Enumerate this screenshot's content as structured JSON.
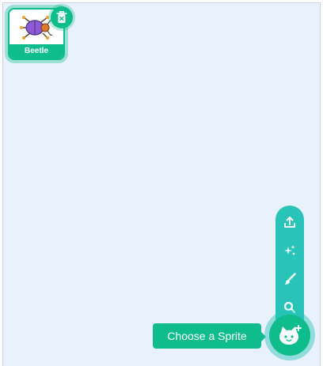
{
  "sprite_list": {
    "sprites": [
      {
        "name": "Beetle",
        "thumbnail_icon": "beetle-icon",
        "selected": true
      }
    ],
    "delete_icon": "trash-icon"
  },
  "sprite_menu": {
    "items": [
      {
        "icon": "upload-icon"
      },
      {
        "icon": "surprise-icon"
      },
      {
        "icon": "paint-icon"
      },
      {
        "icon": "search-icon"
      }
    ],
    "main_button_icon": "cat-plus-icon",
    "tooltip": "Choose a Sprite"
  },
  "colors": {
    "pane_background": "#e9f1fc",
    "accent": "#0fbd8c",
    "menu_background": "#29c4b9"
  }
}
